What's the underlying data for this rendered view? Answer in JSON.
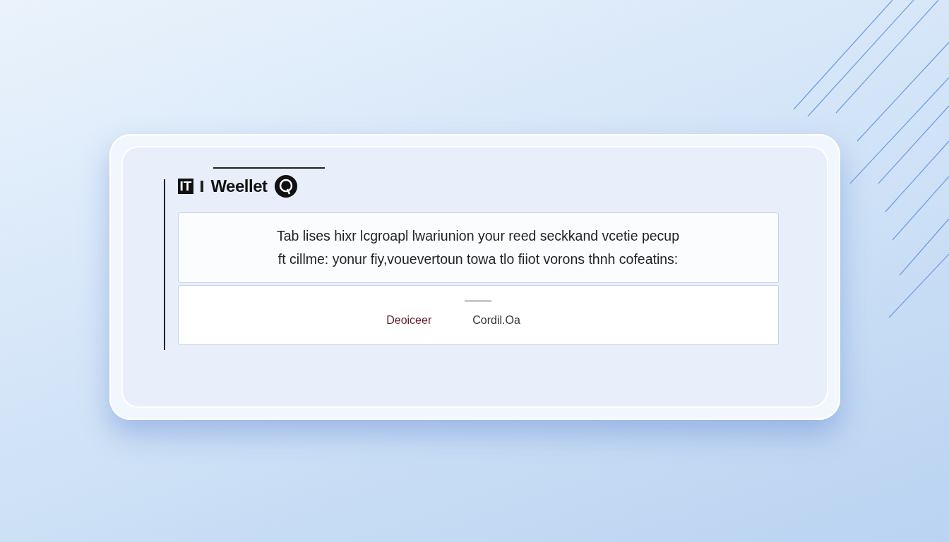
{
  "brand": {
    "logo": "IT",
    "name": "Weellet"
  },
  "message": [
    "Tab lises hixr lcgroapl lwariunion your reed seckkand vcetie pecup",
    "ft cillme: yonur fiy,vouevertoun towa tlo fiiot vorons thnh cofeatins:"
  ],
  "buttons": [
    {
      "label": "Deoiceer",
      "kind": "primary"
    },
    {
      "label": "Cordil.Oa",
      "kind": "secondary"
    }
  ]
}
